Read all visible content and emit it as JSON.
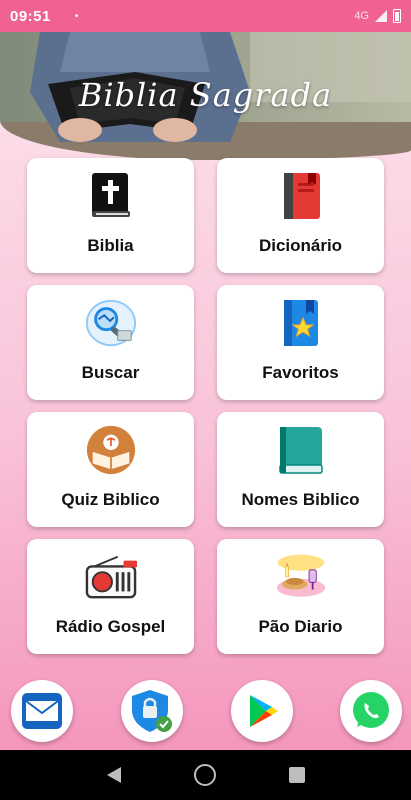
{
  "status": {
    "time": "09:51",
    "dot": "•",
    "network": "4G"
  },
  "header": {
    "title": "Biblia Sagrada"
  },
  "menu": [
    {
      "label": "Biblia",
      "icon": "bible-book-icon"
    },
    {
      "label": "Dicionário",
      "icon": "dictionary-book-icon"
    },
    {
      "label": "Buscar",
      "icon": "search-magnifier-icon"
    },
    {
      "label": "Favoritos",
      "icon": "bookmark-star-icon"
    },
    {
      "label": "Quiz Biblico",
      "icon": "quiz-book-icon"
    },
    {
      "label": "Nomes Biblico",
      "icon": "green-book-icon"
    },
    {
      "label": "Rádio Gospel",
      "icon": "radio-icon"
    },
    {
      "label": "Pão Diario",
      "icon": "bread-table-icon"
    }
  ],
  "shortcuts": [
    {
      "icon": "mail-icon"
    },
    {
      "icon": "security-shield-icon"
    },
    {
      "icon": "play-store-icon"
    },
    {
      "icon": "whatsapp-icon"
    }
  ],
  "colors": {
    "status_bar": "#f06292",
    "background_top": "#fde6ef",
    "background_bottom": "#f48fb8",
    "card": "#ffffff"
  }
}
